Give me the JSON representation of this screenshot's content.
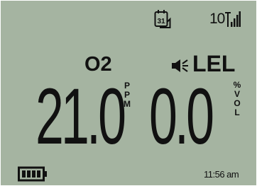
{
  "status": {
    "calendar_icon": "calendar-31-icon",
    "calendar_day": "31",
    "signal_value": "10",
    "signal_icon": "signal-bars-icon"
  },
  "channels": [
    {
      "gas": "O2",
      "value": "21.0",
      "unit_letters": [
        "P",
        "P",
        "M"
      ]
    },
    {
      "gas": "LEL",
      "value": "0.0",
      "unit_letters": [
        "%",
        "V",
        "O",
        "L"
      ],
      "alarm_icon": "speaker-icon"
    }
  ],
  "footer": {
    "battery_icon": "battery-icon",
    "time": "11:56 am"
  },
  "colors": {
    "lcd_background": "#a5b4a1",
    "foreground": "#111111"
  }
}
